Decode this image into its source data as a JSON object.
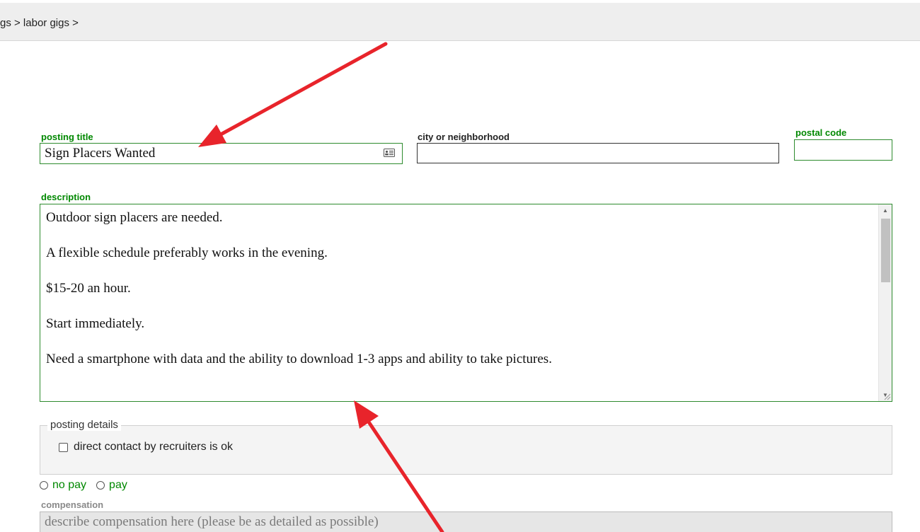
{
  "breadcrumb": {
    "text": "gs > labor gigs >"
  },
  "form": {
    "posting_title": {
      "label": "posting title",
      "value": "Sign Placers Wanted"
    },
    "city": {
      "label": "city or neighborhood",
      "value": ""
    },
    "postal_code": {
      "label": "postal code",
      "value": ""
    },
    "description": {
      "label": "description",
      "paragraphs": [
        "Outdoor sign placers are needed.",
        "A flexible schedule preferably works in the evening.",
        "$15-20 an hour.",
        "Start immediately.",
        "Need a smartphone with data and the ability to download 1-3 apps and ability to take pictures."
      ]
    },
    "posting_details": {
      "legend": "posting details",
      "recruiters_checkbox": {
        "label": "direct contact by recruiters is ok",
        "checked": false
      }
    },
    "pay_options": {
      "no_pay_label": "no pay",
      "pay_label": "pay"
    },
    "compensation": {
      "label": "compensation",
      "placeholder": "describe compensation here (please be as detailed as possible)"
    }
  },
  "icons": {
    "title_field_icon": "contact-card-icon",
    "scroll_up": "scroll-up-arrow-icon",
    "scroll_down": "scroll-down-arrow-icon",
    "resize": "resize-grip-icon"
  },
  "colors": {
    "label_green": "#008800",
    "border_green": "#2e8b2e",
    "annotation_red": "#e8242b",
    "topbar_bg": "#eeeeee"
  }
}
